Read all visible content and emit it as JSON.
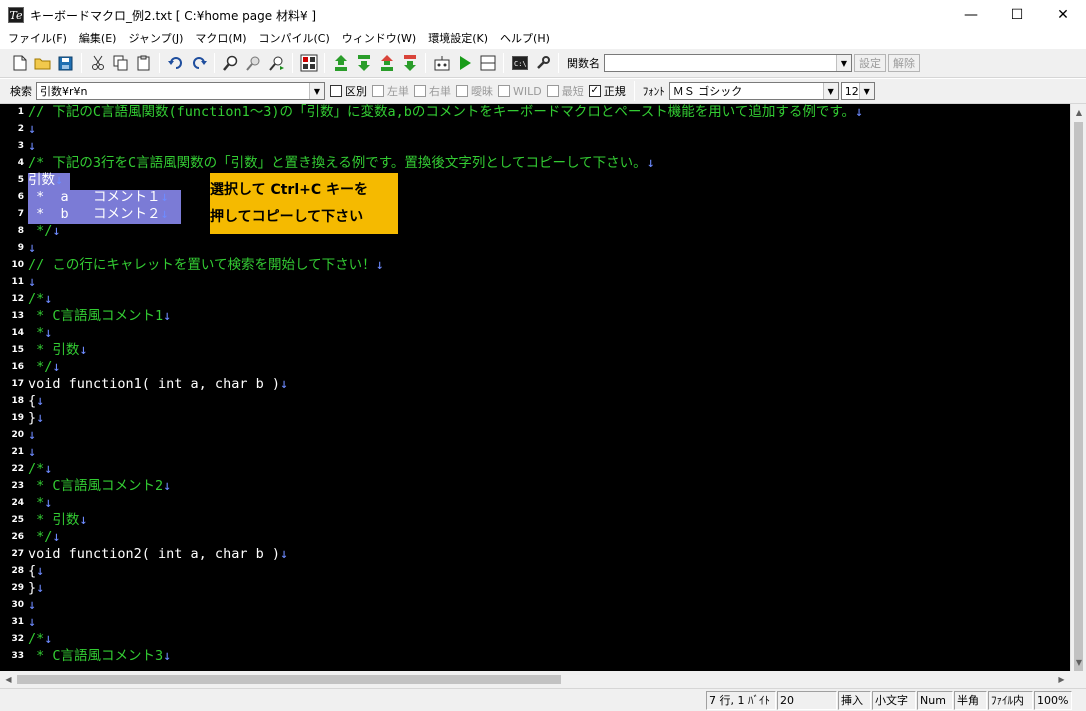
{
  "window": {
    "icon_letter": "Te",
    "title": "キーボードマクロ_例2.txt [ C:¥home page 材料¥ ]",
    "minimize": "—",
    "maximize": "☐",
    "close": "✕"
  },
  "menu": [
    "ファイル(F)",
    "編集(E)",
    "ジャンプ(J)",
    "マクロ(M)",
    "コンパイル(C)",
    "ウィンドウ(W)",
    "環境設定(K)",
    "ヘルプ(H)"
  ],
  "toolbar1": {
    "func_label": "関数名",
    "func_value": "",
    "set_button": "設定",
    "release_button": "解除"
  },
  "toolbar2": {
    "search_label": "検索",
    "search_value": "引数¥r¥n",
    "options": [
      {
        "label": "区別",
        "checked": false,
        "enabled": true
      },
      {
        "label": "左単",
        "checked": false,
        "enabled": false
      },
      {
        "label": "右単",
        "checked": false,
        "enabled": false
      },
      {
        "label": "曖昧",
        "checked": false,
        "enabled": false
      },
      {
        "label": "WILD",
        "checked": false,
        "enabled": false
      },
      {
        "label": "最短",
        "checked": false,
        "enabled": false
      },
      {
        "label": "正規",
        "checked": true,
        "enabled": true
      }
    ],
    "checkmark": "✓",
    "font_label": "ﾌｫﾝﾄ",
    "font_value": "ＭＳ ゴシック",
    "size_value": "12"
  },
  "editor": {
    "crlf": "↓",
    "lines": [
      {
        "n": "1",
        "text": "// 下記のC言語風関数(function1～3)の「引数」に変数a,bのコメントをキーボードマクロとペースト機能を用いて追加する例です。",
        "color": "green"
      },
      {
        "n": "2",
        "text": "",
        "color": "white"
      },
      {
        "n": "3",
        "text": "",
        "color": "white"
      },
      {
        "n": "4",
        "text": "/* 下記の3行をC言語風関数の「引数」と置き換える例です。置換後文字列としてコピーして下さい。",
        "color": "green"
      },
      {
        "n": "5",
        "text": "引数",
        "color": "white"
      },
      {
        "n": "6",
        "text": " *  a   コメント１",
        "color": "white"
      },
      {
        "n": "7",
        "text": " *  b   コメント２",
        "color": "white"
      },
      {
        "n": "8",
        "text": " */",
        "color": "green"
      },
      {
        "n": "9",
        "text": "",
        "color": "white"
      },
      {
        "n": "10",
        "text": "// この行にキャレットを置いて検索を開始して下さい！",
        "color": "green"
      },
      {
        "n": "11",
        "text": "",
        "color": "white"
      },
      {
        "n": "12",
        "text": "/*",
        "color": "green"
      },
      {
        "n": "13",
        "text": " * C言語風コメント1",
        "color": "green"
      },
      {
        "n": "14",
        "text": " *",
        "color": "green"
      },
      {
        "n": "15",
        "text": " * 引数",
        "color": "green"
      },
      {
        "n": "16",
        "text": " */",
        "color": "green"
      },
      {
        "n": "17",
        "text": "void function1( int a, char b )",
        "color": "white"
      },
      {
        "n": "18",
        "text": "{",
        "color": "white"
      },
      {
        "n": "19",
        "text": "}",
        "color": "white"
      },
      {
        "n": "20",
        "text": "",
        "color": "white"
      },
      {
        "n": "21",
        "text": "",
        "color": "white"
      },
      {
        "n": "22",
        "text": "/*",
        "color": "green"
      },
      {
        "n": "23",
        "text": " * C言語風コメント2",
        "color": "green"
      },
      {
        "n": "24",
        "text": " *",
        "color": "green"
      },
      {
        "n": "25",
        "text": " * 引数",
        "color": "green"
      },
      {
        "n": "26",
        "text": " */",
        "color": "green"
      },
      {
        "n": "27",
        "text": "void function2( int a, char b )",
        "color": "white"
      },
      {
        "n": "28",
        "text": "{",
        "color": "white"
      },
      {
        "n": "29",
        "text": "}",
        "color": "white"
      },
      {
        "n": "30",
        "text": "",
        "color": "white"
      },
      {
        "n": "31",
        "text": "",
        "color": "white"
      },
      {
        "n": "32",
        "text": "/*",
        "color": "green"
      },
      {
        "n": "33",
        "text": " * C言語風コメント3",
        "color": "green"
      }
    ],
    "callout_line1": "選択して Ctrl+C キーを",
    "callout_line2": "押してコピーして下さい"
  },
  "status": {
    "position": "7 行, 1 ﾊﾞｲﾄ",
    "column": "20",
    "insert": "挿入",
    "case": "小文字",
    "num": "Num",
    "width": "半角",
    "scope": "ﾌｧｲﾙ内",
    "zoom": "100%"
  },
  "colors": {
    "comment": "#33cc33",
    "code": "#ffffff",
    "crlf": "#6e8bff",
    "selection": "#7b7bd6",
    "callout": "#f5ba00"
  }
}
